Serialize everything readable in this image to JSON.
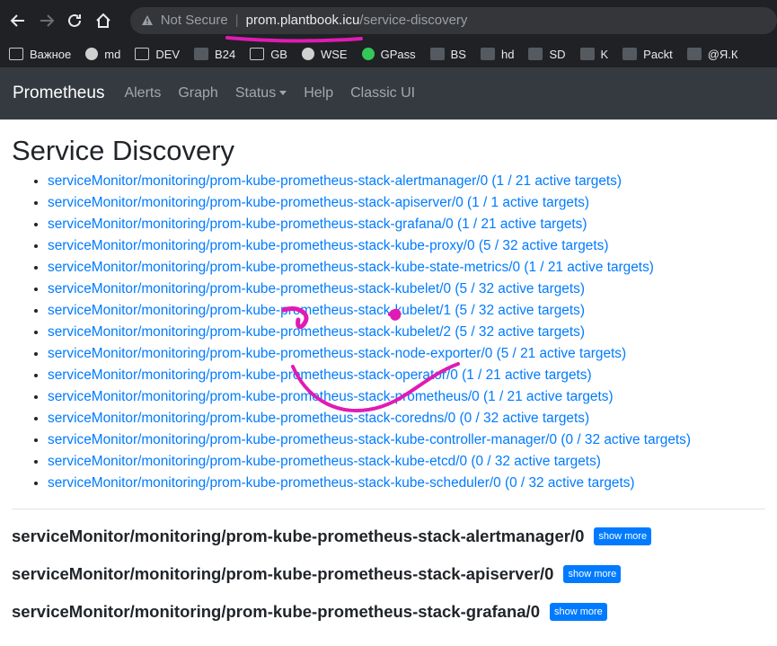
{
  "browser": {
    "security_label": "Not Secure",
    "url_host": "prom.plantbook.icu",
    "url_path": "/service-discovery",
    "bookmarks": [
      {
        "label": "Важное",
        "icon": "folder-icon"
      },
      {
        "label": "md",
        "icon": "globe-icon"
      },
      {
        "label": "DEV",
        "icon": "folder-icon"
      },
      {
        "label": "B24",
        "icon": "b24-icon"
      },
      {
        "label": "GB",
        "icon": "folder-icon"
      },
      {
        "label": "WSE",
        "icon": "globe-icon"
      },
      {
        "label": "GPass",
        "icon": "green-dot-icon"
      },
      {
        "label": "BS",
        "icon": "w-icon"
      },
      {
        "label": "hd",
        "icon": "check-icon"
      },
      {
        "label": "SD",
        "icon": "sd-icon"
      },
      {
        "label": "K",
        "icon": "k-icon"
      },
      {
        "label": "Packt",
        "icon": "packt-icon"
      },
      {
        "label": "@Я.К",
        "icon": "flag-icon"
      }
    ]
  },
  "navbar": {
    "brand": "Prometheus",
    "links": [
      "Alerts",
      "Graph",
      "Status",
      "Help",
      "Classic UI"
    ]
  },
  "page": {
    "title": "Service Discovery",
    "targets": [
      {
        "name": "serviceMonitor/monitoring/prom-kube-prometheus-stack-alertmanager/0",
        "count": "(1 / 21 active targets)"
      },
      {
        "name": "serviceMonitor/monitoring/prom-kube-prometheus-stack-apiserver/0",
        "count": "(1 / 1 active targets)"
      },
      {
        "name": "serviceMonitor/monitoring/prom-kube-prometheus-stack-grafana/0",
        "count": "(1 / 21 active targets)"
      },
      {
        "name": "serviceMonitor/monitoring/prom-kube-prometheus-stack-kube-proxy/0",
        "count": "(5 / 32 active targets)"
      },
      {
        "name": "serviceMonitor/monitoring/prom-kube-prometheus-stack-kube-state-metrics/0",
        "count": "(1 / 21 active targets)"
      },
      {
        "name": "serviceMonitor/monitoring/prom-kube-prometheus-stack-kubelet/0",
        "count": "(5 / 32 active targets)"
      },
      {
        "name": "serviceMonitor/monitoring/prom-kube-prometheus-stack-kubelet/1",
        "count": "(5 / 32 active targets)"
      },
      {
        "name": "serviceMonitor/monitoring/prom-kube-prometheus-stack-kubelet/2",
        "count": "(5 / 32 active targets)"
      },
      {
        "name": "serviceMonitor/monitoring/prom-kube-prometheus-stack-node-exporter/0",
        "count": "(5 / 21 active targets)"
      },
      {
        "name": "serviceMonitor/monitoring/prom-kube-prometheus-stack-operator/0",
        "count": "(1 / 21 active targets)"
      },
      {
        "name": "serviceMonitor/monitoring/prom-kube-prometheus-stack-prometheus/0",
        "count": "(1 / 21 active targets)"
      },
      {
        "name": "serviceMonitor/monitoring/prom-kube-prometheus-stack-coredns/0",
        "count": "(0 / 32 active targets)"
      },
      {
        "name": "serviceMonitor/monitoring/prom-kube-prometheus-stack-kube-controller-manager/0",
        "count": "(0 / 32 active targets)"
      },
      {
        "name": "serviceMonitor/monitoring/prom-kube-prometheus-stack-kube-etcd/0",
        "count": "(0 / 32 active targets)"
      },
      {
        "name": "serviceMonitor/monitoring/prom-kube-prometheus-stack-kube-scheduler/0",
        "count": "(0 / 32 active targets)"
      }
    ],
    "sections": [
      {
        "title": "serviceMonitor/monitoring/prom-kube-prometheus-stack-alertmanager/0",
        "button": "show more"
      },
      {
        "title": "serviceMonitor/monitoring/prom-kube-prometheus-stack-apiserver/0",
        "button": "show more"
      },
      {
        "title": "serviceMonitor/monitoring/prom-kube-prometheus-stack-grafana/0",
        "button": "show more"
      }
    ]
  },
  "colors": {
    "link": "#007bff",
    "navbar_bg": "#343a40",
    "annotation": "#e01bb4"
  }
}
